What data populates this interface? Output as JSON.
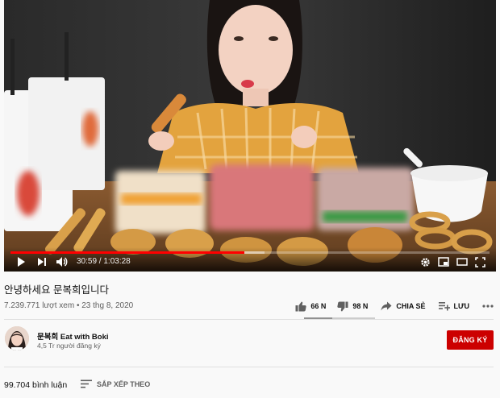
{
  "player": {
    "current_time": "30:59",
    "duration": "1:03:28",
    "separator": " / ",
    "progress": 0.488,
    "buffered": 0.53,
    "colors": {
      "progress": "#ff0000"
    }
  },
  "video": {
    "title": "안녕하세요 문복희입니다",
    "views": "7.239.771 lượt xem",
    "dot": " • ",
    "date": "23 thg 8, 2020"
  },
  "actions": {
    "likes": "66 N",
    "dislikes": "98 N",
    "share": "CHIA SẺ",
    "save": "LƯU",
    "like_ratio": 0.4
  },
  "channel": {
    "name": "문복희 Eat with Boki",
    "subscribers": "4,5 Tr người đăng ký",
    "subscribe_label": "ĐĂNG KÝ",
    "subscribe_color": "#cc0000"
  },
  "comments": {
    "count": "99.704 bình luận",
    "sort_label": "SẮP XẾP THEO"
  }
}
